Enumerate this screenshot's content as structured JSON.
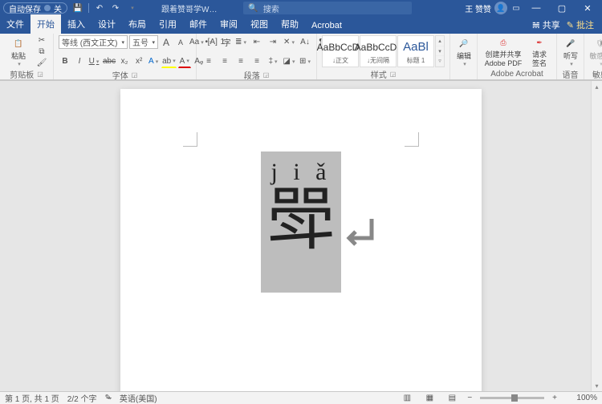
{
  "titlebar": {
    "autosave_label": "自动保存",
    "autosave_state": "关",
    "doc_title": "跟着赞哥学W…",
    "search_placeholder": "搜索",
    "user_name": "王 赞赞"
  },
  "tabs": {
    "items": [
      "文件",
      "开始",
      "插入",
      "设计",
      "布局",
      "引用",
      "邮件",
      "审阅",
      "视图",
      "帮助",
      "Acrobat"
    ],
    "active_index": 1,
    "share_label": "共享",
    "comments_label": "批注"
  },
  "ribbon": {
    "clipboard": {
      "paste_label": "粘贴",
      "group_label": "剪贴板"
    },
    "font": {
      "font_name": "等线 (西文正文)",
      "font_size": "五号",
      "group_label": "字体",
      "b": "B",
      "i": "I",
      "u": "U",
      "s": "abc",
      "sub": "x₂",
      "sup": "x²",
      "A_fx": "A",
      "Aa": "Aa",
      "clear": "Aᵩ",
      "grow": "A",
      "shrink": "A",
      "phon": "[A]",
      "enc": "字"
    },
    "paragraph": {
      "group_label": "段落",
      "bul": "•",
      "num": "1",
      "ml": "≣",
      "dec": "⇤",
      "inc": "⇥",
      "sort": "A↓",
      "showmarks": "¶",
      "al": "≡",
      "ac": "≡",
      "ar": "≡",
      "aj": "≡",
      "ls": "‡",
      "shade": "◪",
      "border": "⊞",
      "asian": "✕"
    },
    "styles": {
      "group_label": "样式",
      "box1_prev": "AaBbCcDc",
      "box1_name": "↓正文",
      "box2_prev": "AaBbCcDc",
      "box2_name": "↓无间隔",
      "box3_prev": "AaBl",
      "box3_name": "标题 1"
    },
    "editing": {
      "label": "编辑"
    },
    "acrobat": {
      "create_label": "创建并共享",
      "create_sub": "Adobe PDF",
      "sign_label": "请求",
      "sign_sub": "签名",
      "group_label": "Adobe Acrobat"
    },
    "voice": {
      "dictate_label": "听写",
      "group_label": "语音"
    },
    "sensitivity": {
      "label": "敏感度",
      "group_label": "敏感度"
    }
  },
  "document": {
    "pinyin": "j i ǎ",
    "hanzi": "斝"
  },
  "status": {
    "page_info": "第 1 页, 共 1 页",
    "word_count": "2/2 个字",
    "lang_label": "英语(美国)",
    "zoom": "100%"
  }
}
